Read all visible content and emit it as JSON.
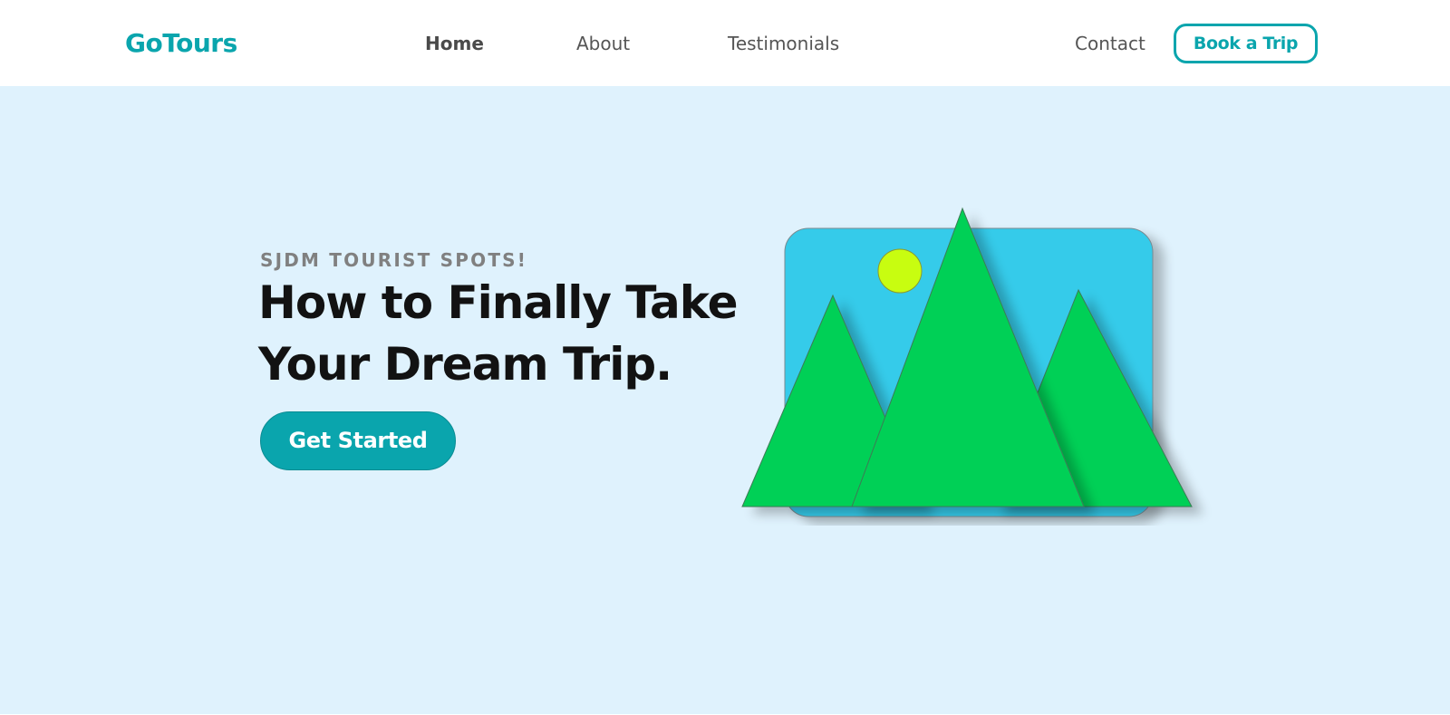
{
  "brand": {
    "name": "GoTours",
    "color": "#0aa5ad"
  },
  "nav": {
    "items": [
      {
        "label": "Home",
        "active": true
      },
      {
        "label": "About",
        "active": false
      },
      {
        "label": "Testimonials",
        "active": false
      },
      {
        "label": "Contact",
        "active": false
      }
    ],
    "cta_label": "Book a Trip"
  },
  "hero": {
    "eyebrow": "SJDM TOURIST SPOTS!",
    "title": "How to Finally Take Your Dream Trip.",
    "cta_label": "Get Started",
    "background": "#dff2fd"
  },
  "illustration": {
    "icon": "mountain-landscape-icon",
    "colors": {
      "sky": "#35cbea",
      "mountain": "#00d057",
      "sun": "#c8fd10"
    }
  }
}
